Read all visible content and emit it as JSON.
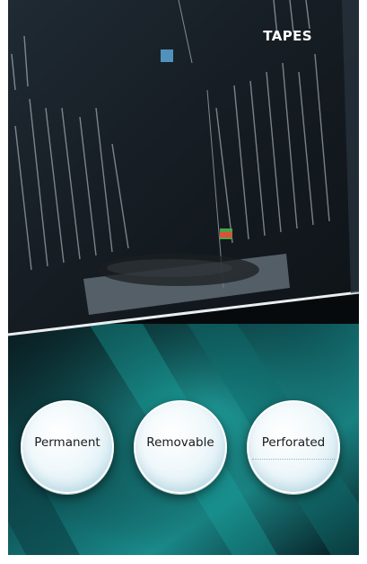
{
  "header": {
    "title": "TAPES"
  },
  "tape_options": [
    {
      "label": "Permanent"
    },
    {
      "label": "Removable"
    },
    {
      "label": "Perforated"
    }
  ]
}
